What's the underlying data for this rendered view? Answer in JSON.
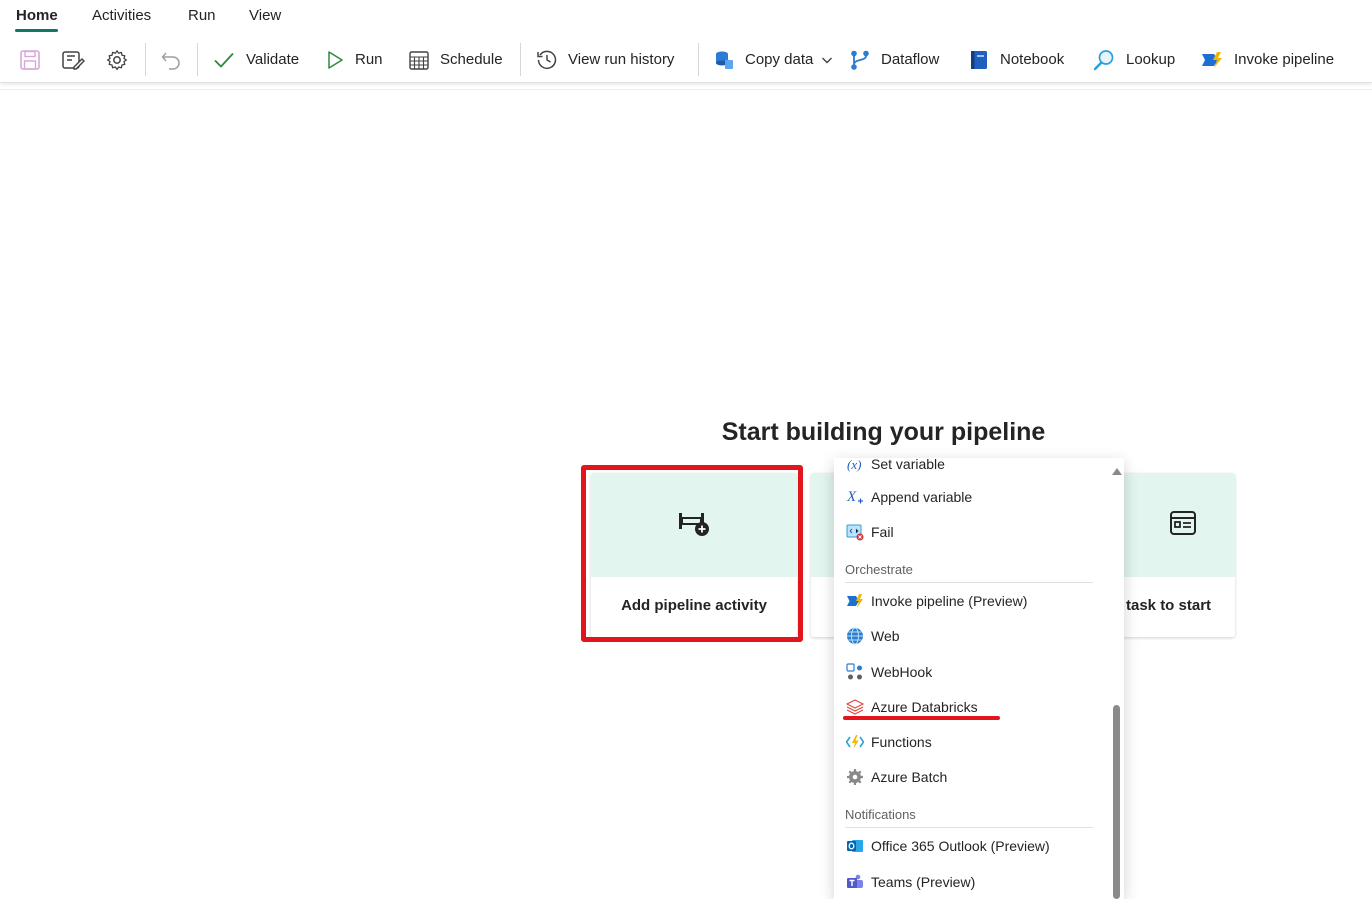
{
  "tabs": [
    {
      "label": "Home",
      "active": true
    },
    {
      "label": "Activities"
    },
    {
      "label": "Run"
    },
    {
      "label": "View"
    }
  ],
  "toolbar": {
    "validate": "Validate",
    "run": "Run",
    "schedule": "Schedule",
    "view_run_history": "View run history",
    "copy_data": "Copy data",
    "dataflow": "Dataflow",
    "notebook": "Notebook",
    "lookup": "Lookup",
    "invoke_pipeline": "Invoke pipeline"
  },
  "main": {
    "heading": "Start building your pipeline",
    "cards": [
      {
        "label": "Add pipeline activity"
      },
      {
        "label": "task to start"
      }
    ]
  },
  "menu": {
    "items_top": [
      {
        "label": "Set variable",
        "icon": "variable-icon"
      },
      {
        "label": "Append variable",
        "icon": "append-variable-icon"
      },
      {
        "label": "Fail",
        "icon": "fail-icon"
      }
    ],
    "sections": [
      {
        "title": "Orchestrate",
        "items": [
          {
            "label": "Invoke pipeline (Preview)",
            "icon": "invoke-pipeline-icon"
          },
          {
            "label": "Web",
            "icon": "globe-icon"
          },
          {
            "label": "WebHook",
            "icon": "webhook-icon"
          },
          {
            "label": "Azure Databricks",
            "icon": "databricks-icon"
          },
          {
            "label": "Functions",
            "icon": "functions-icon"
          },
          {
            "label": "Azure Batch",
            "icon": "gear-icon"
          }
        ]
      },
      {
        "title": "Notifications",
        "items": [
          {
            "label": "Office 365 Outlook (Preview)",
            "icon": "outlook-icon"
          },
          {
            "label": "Teams (Preview)",
            "icon": "teams-icon"
          }
        ]
      }
    ]
  },
  "colors": {
    "accent": "#117865",
    "card_top": "#e2f5ee",
    "highlight_red": "#e3151c"
  }
}
